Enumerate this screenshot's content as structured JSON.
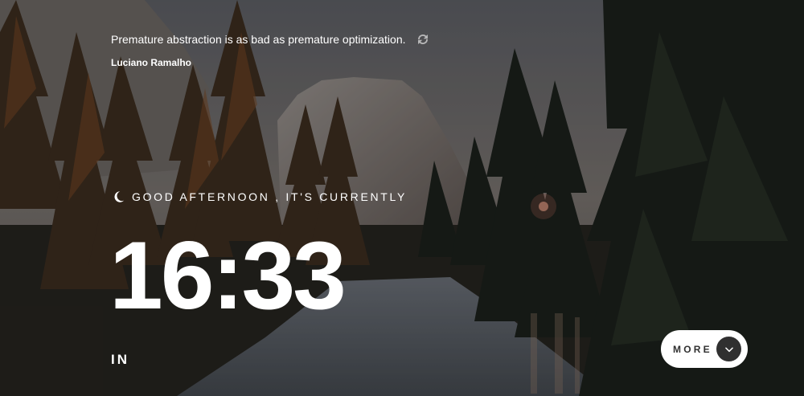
{
  "quote": {
    "text": "Premature abstraction is as bad as premature optimization.",
    "author": "Luciano Ramalho",
    "refresh_icon": "refresh-icon"
  },
  "greeting": {
    "icon": "moon-icon",
    "text": "GOOD AFTERNOON , IT'S CURRENTLY"
  },
  "clock": {
    "time": "16:33",
    "zone": "IN"
  },
  "more_button": {
    "label": "MORE",
    "icon": "chevron-down-icon"
  },
  "colors": {
    "text": "#ffffff",
    "button_bg": "#ffffff",
    "button_text": "#303030",
    "chevron_bg": "#303030"
  }
}
